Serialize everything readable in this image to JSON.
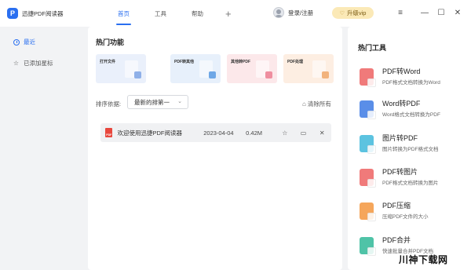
{
  "app": {
    "title": "迅捷PDF阅读器",
    "logo_letter": "P"
  },
  "nav": {
    "tabs": [
      "首页",
      "工具",
      "帮助"
    ],
    "active_index": 0,
    "plus": "+"
  },
  "user": {
    "login_label": "登录/注册",
    "vip_label": "升级vip",
    "vip_icon": "♡"
  },
  "window_controls": {
    "menu": "≡",
    "minimize": "—",
    "maximize": "☐",
    "close": "✕"
  },
  "sidebar": {
    "items": [
      {
        "label": "最近",
        "icon": "clock-icon",
        "active": true
      },
      {
        "label": "已添加星标",
        "icon": "star-icon",
        "active": false
      }
    ]
  },
  "main": {
    "section_title": "热门功能",
    "cards": [
      {
        "label": "打开文件",
        "color": "#eaf0fb",
        "badge": "#8fb0e8"
      },
      {
        "label": "PDF转其他",
        "color": "#e7f0fb",
        "badge": "#6ea7e6"
      },
      {
        "label": "其他转PDF",
        "color": "#fce8ea",
        "badge": "#ef8fa0"
      },
      {
        "label": "PDF处理",
        "color": "#fdeee2",
        "badge": "#f2b37d"
      }
    ],
    "sort_label": "排序依据:",
    "sort_value": "最新的排第一",
    "clear_all": "清除所有",
    "files": [
      {
        "name": "欢迎使用迅捷PDF阅读器",
        "date": "2023-04-04",
        "size": "0.42M"
      }
    ]
  },
  "right": {
    "title": "热门工具",
    "tools": [
      {
        "name": "PDF转Word",
        "desc": "PDF格式文档转换为Word",
        "color": "#f07a7a",
        "icon": "pdf-to-word-icon"
      },
      {
        "name": "Word转PDF",
        "desc": "Word格式文档转换为PDF",
        "color": "#5a8ee8",
        "icon": "word-to-pdf-icon"
      },
      {
        "name": "图片转PDF",
        "desc": "图片转换为PDF格式文档",
        "color": "#5cc3e0",
        "icon": "image-to-pdf-icon"
      },
      {
        "name": "PDF转图片",
        "desc": "PDF格式文档转换为图片",
        "color": "#f07a7a",
        "icon": "pdf-to-image-icon"
      },
      {
        "name": "PDF压缩",
        "desc": "压缩PDF文件的大小",
        "color": "#f5a65b",
        "icon": "pdf-compress-icon"
      },
      {
        "name": "PDF合并",
        "desc": "快速批量合并PDF文档",
        "color": "#4fc3a7",
        "icon": "pdf-merge-icon"
      }
    ]
  },
  "watermark": "川神下载网"
}
